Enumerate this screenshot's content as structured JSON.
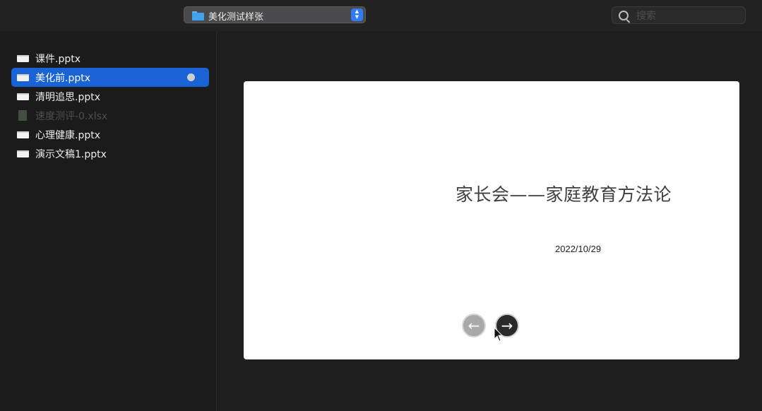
{
  "toolbar": {
    "location_label": "美化测试样张",
    "stepper_up": "▲",
    "stepper_down": "▼",
    "search_placeholder": "搜索"
  },
  "sidebar": {
    "files": [
      {
        "name": "课件.pptx",
        "icon": "pptx-file-icon",
        "state": "normal"
      },
      {
        "name": "美化前.pptx",
        "icon": "pptx-file-icon",
        "state": "selected"
      },
      {
        "name": "清明追思.pptx",
        "icon": "pptx-file-icon",
        "state": "normal"
      },
      {
        "name": "速度测评-0.xlsx",
        "icon": "xlsx-file-icon",
        "state": "disabled"
      },
      {
        "name": "心理健康.pptx",
        "icon": "pptx-file-icon",
        "state": "normal"
      },
      {
        "name": "演示文稿1.pptx",
        "icon": "pptx-file-icon",
        "state": "normal"
      }
    ]
  },
  "preview": {
    "slide_title": "家长会——家庭教育方法论",
    "slide_date": "2022/10/29",
    "prev_icon": "←",
    "next_icon": "→"
  },
  "colors": {
    "selection": "#1a63d6",
    "folder": "#3fa3ef",
    "stepper": "#2f7cf6"
  }
}
